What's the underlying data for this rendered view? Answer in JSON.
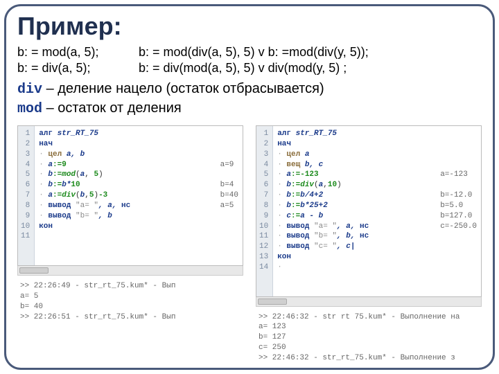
{
  "title": "Пример:",
  "eq": {
    "r1c1": "b: = mod(a, 5);",
    "r1c2": "b: = mod(div(a, 5), 5) v b: =mod(div(y, 5));",
    "r2c1": "b: = div(a, 5);",
    "r2c2": "b: = div(mod(a, 5), 5) v div(mod(y, 5) ;"
  },
  "notes": {
    "div_kw": "div",
    "div_txt": " – деление нацело (остаток отбрасывается)",
    "mod_kw": "mod",
    "mod_txt": " – остаток от деления"
  },
  "left": {
    "gutter": " 1\n 2\n 3\n 4\n 5\n 6\n 7\n 8\n 9\n10\n11",
    "lines": {
      "l1a": "алг ",
      "l1b": "str_RT_75",
      "l2": "нач",
      "l3a": "· ",
      "l3b": "цел ",
      "l3c": "a, b",
      "l4a": "· ",
      "l4b": "a",
      "l4c": ":=",
      "l4d": "9",
      "l5a": "· ",
      "l5b": "b",
      "l5c": ":=",
      "l5d": "mod",
      "l5e": "(",
      "l5f": "a",
      "l5g": ", ",
      "l5h": "5",
      "l5i": ")",
      "l6a": "· ",
      "l6b": "b",
      "l6c": ":=",
      "l6d": "b*",
      "l6e": "10",
      "l7a": "· ",
      "l7b": "a",
      "l7c": ":=",
      "l7d": "div",
      "l7e": "(",
      "l7f": "b",
      "l7g": ",",
      "l7h": "5",
      "l7i": ")",
      "l7j": "-3",
      "l8a": "· ",
      "l8b": "вывод ",
      "l8c": "\"a= \"",
      "l8d": ", a, ",
      "l8e": "нс",
      "l9a": "· ",
      "l9b": "вывод ",
      "l9c": "\"b= \"",
      "l9d": ", b",
      "l10": "кон"
    },
    "side": "\n\n\na=9\n\nb=4\nb=40\na=5",
    "console": ">> 22:26:49 - str_rt_75.kum* - Вып\na= 5\nb= 40\n>> 22:26:51 - str_rt_75.kum* - Вып"
  },
  "right": {
    "gutter": " 1\n 2\n 3\n 4\n 5\n 6\n 7\n 8\n 9\n10\n11\n12\n13\n14",
    "lines": {
      "l1a": "алг ",
      "l1b": "str_RT_75",
      "l2": "нач",
      "l3a": "· ",
      "l3b": "цел ",
      "l3c": "a",
      "l4a": "· ",
      "l4b": "вещ ",
      "l4c": "b, c",
      "l5a": "· ",
      "l5b": "a",
      "l5c": ":=",
      "l5d": "-123",
      "l6a": "· ",
      "l6b": "b",
      "l6c": ":=",
      "l6d": "div",
      "l6e": "(",
      "l6f": "a",
      "l6g": ",",
      "l6h": "10",
      "l6i": ")",
      "l7a": "· ",
      "l7b": "b",
      "l7c": ":=",
      "l7d": "b/4+2",
      "l8a": "· ",
      "l8b": "b",
      "l8c": ":=",
      "l8d": "b*25+2",
      "l9a": "· ",
      "l9b": "c",
      "l9c": ":=",
      "l9d": "a - b",
      "l10a": "· ",
      "l10b": "вывод ",
      "l10c": "\"a= \"",
      "l10d": ", a, ",
      "l10e": "нс",
      "l11a": "· ",
      "l11b": "вывод ",
      "l11c": "\"b= \"",
      "l11d": ", b, ",
      "l11e": "нс",
      "l12a": "· ",
      "l12b": "вывод ",
      "l12c": "\"c= \"",
      "l12d": ", c|",
      "l13": "кон",
      "l14": "·"
    },
    "side": "\n\n\n\na=-123\n\nb=-12.0\nb=5.0\nb=127.0\nc=-250.0",
    "console": ">> 22:46:32 - str rt 75.kum* - Выполнение на\na= 123\nb= 127\nc= 250\n>> 22:46:32 - str_rt_75.kum* - Выполнение з"
  }
}
